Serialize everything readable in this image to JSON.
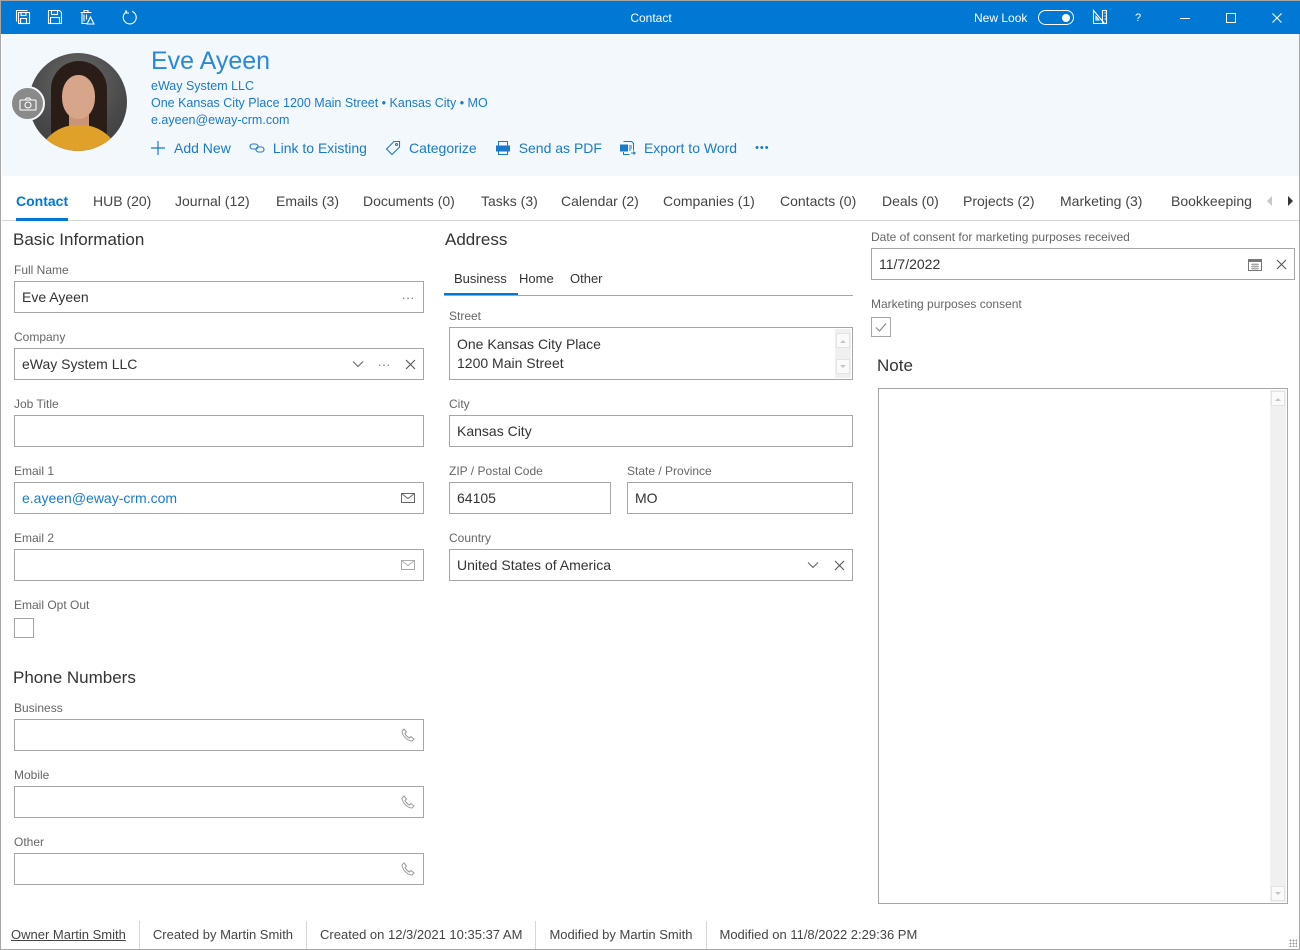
{
  "titlebar": {
    "title": "Contact",
    "new_look_label": "New Look",
    "new_look_enabled": true,
    "icons": [
      "save-and-close-icon",
      "save-icon",
      "delete-icon",
      "reload-icon"
    ],
    "right_icons": [
      "layout-designer-icon",
      "help-icon",
      "minimize-icon",
      "maximize-icon",
      "close-icon"
    ],
    "help_label": "?"
  },
  "header": {
    "name": "Eve Ayeen",
    "company": "eWay System LLC",
    "address": "One Kansas City Place 1200 Main Street • Kansas City • MO",
    "email": "e.ayeen@eway-crm.com",
    "actions": [
      {
        "label": "Add New",
        "icon": "plus-icon"
      },
      {
        "label": "Link to Existing",
        "icon": "link-icon"
      },
      {
        "label": "Categorize",
        "icon": "tag-icon"
      },
      {
        "label": "Send as PDF",
        "icon": "pdf-icon"
      },
      {
        "label": "Export to Word",
        "icon": "word-export-icon"
      }
    ],
    "more_label": "•••"
  },
  "tabs": [
    {
      "label": "Contact",
      "active": true
    },
    {
      "label": "HUB (20)"
    },
    {
      "label": "Journal (12)"
    },
    {
      "label": "Emails (3)"
    },
    {
      "label": "Documents (0)"
    },
    {
      "label": "Tasks (3)"
    },
    {
      "label": "Calendar (2)"
    },
    {
      "label": "Companies (1)"
    },
    {
      "label": "Contacts (0)"
    },
    {
      "label": "Deals (0)"
    },
    {
      "label": "Projects (2)"
    },
    {
      "label": "Marketing (3)"
    },
    {
      "label": "Bookkeeping"
    }
  ],
  "basic": {
    "title": "Basic Information",
    "full_name_label": "Full Name",
    "full_name": "Eve Ayeen",
    "company_label": "Company",
    "company": "eWay System LLC",
    "job_title_label": "Job Title",
    "job_title": "",
    "email1_label": "Email 1",
    "email1": "e.ayeen@eway-crm.com",
    "email2_label": "Email 2",
    "email2": "",
    "email_opt_out_label": "Email Opt Out",
    "email_opt_out": false
  },
  "phones": {
    "title": "Phone Numbers",
    "business_label": "Business",
    "business": "",
    "mobile_label": "Mobile",
    "mobile": "",
    "other_label": "Other",
    "other": ""
  },
  "address": {
    "title": "Address",
    "tabs": [
      {
        "label": "Business",
        "active": true
      },
      {
        "label": "Home"
      },
      {
        "label": "Other"
      }
    ],
    "street_label": "Street",
    "street_line1": "One Kansas City Place",
    "street_line2": "1200 Main Street",
    "city_label": "City",
    "city": "Kansas City",
    "zip_label": "ZIP / Postal Code",
    "zip": "64105",
    "state_label": "State / Province",
    "state": "MO",
    "country_label": "Country",
    "country": "United States of America"
  },
  "marketing": {
    "consent_date_label": "Date of consent for marketing purposes received",
    "consent_date": "11/7/2022",
    "consent_label": "Marketing purposes consent",
    "consent": true
  },
  "note": {
    "title": "Note",
    "value": ""
  },
  "footer": {
    "owner": "Owner Martin Smith",
    "created_by": "Created by Martin Smith",
    "created_on": "Created on 12/3/2021 10:35:37 AM",
    "modified_by": "Modified by Martin Smith",
    "modified_on": "Modified on 11/8/2022 2:29:36 PM"
  },
  "colors": {
    "accent": "#0078d4",
    "link": "#1b7ac7",
    "header_bg": "#f3f8fd"
  }
}
